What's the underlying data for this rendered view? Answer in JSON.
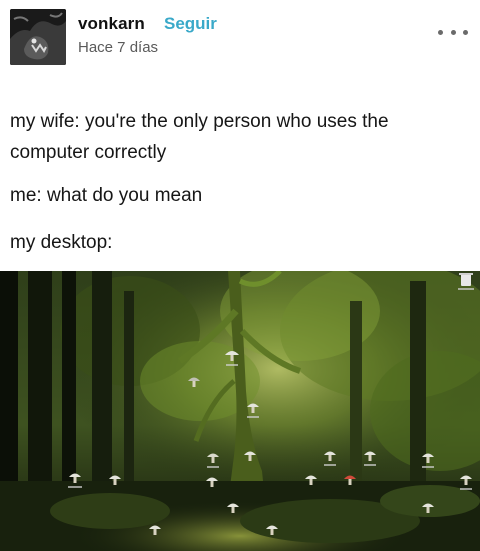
{
  "post": {
    "username": "vonkarn",
    "follow_label": "Seguir",
    "timestamp": "Hace 7 días",
    "more_icon": "ellipsis-icon",
    "avatar_icon": "avatar-image",
    "lines": [
      "my wife: you're the only person who uses the computer correctly",
      "me: what do you mean",
      "my desktop:"
    ]
  },
  "desktop": {
    "wallpaper": "forest-wallpaper",
    "icon_name": "mushroom-icon",
    "recycle_icon": "recycle-bin-icon",
    "colors": {
      "moss": "#6f8f2c",
      "shadow": "#0e140a",
      "light": "#c8d86a"
    }
  }
}
